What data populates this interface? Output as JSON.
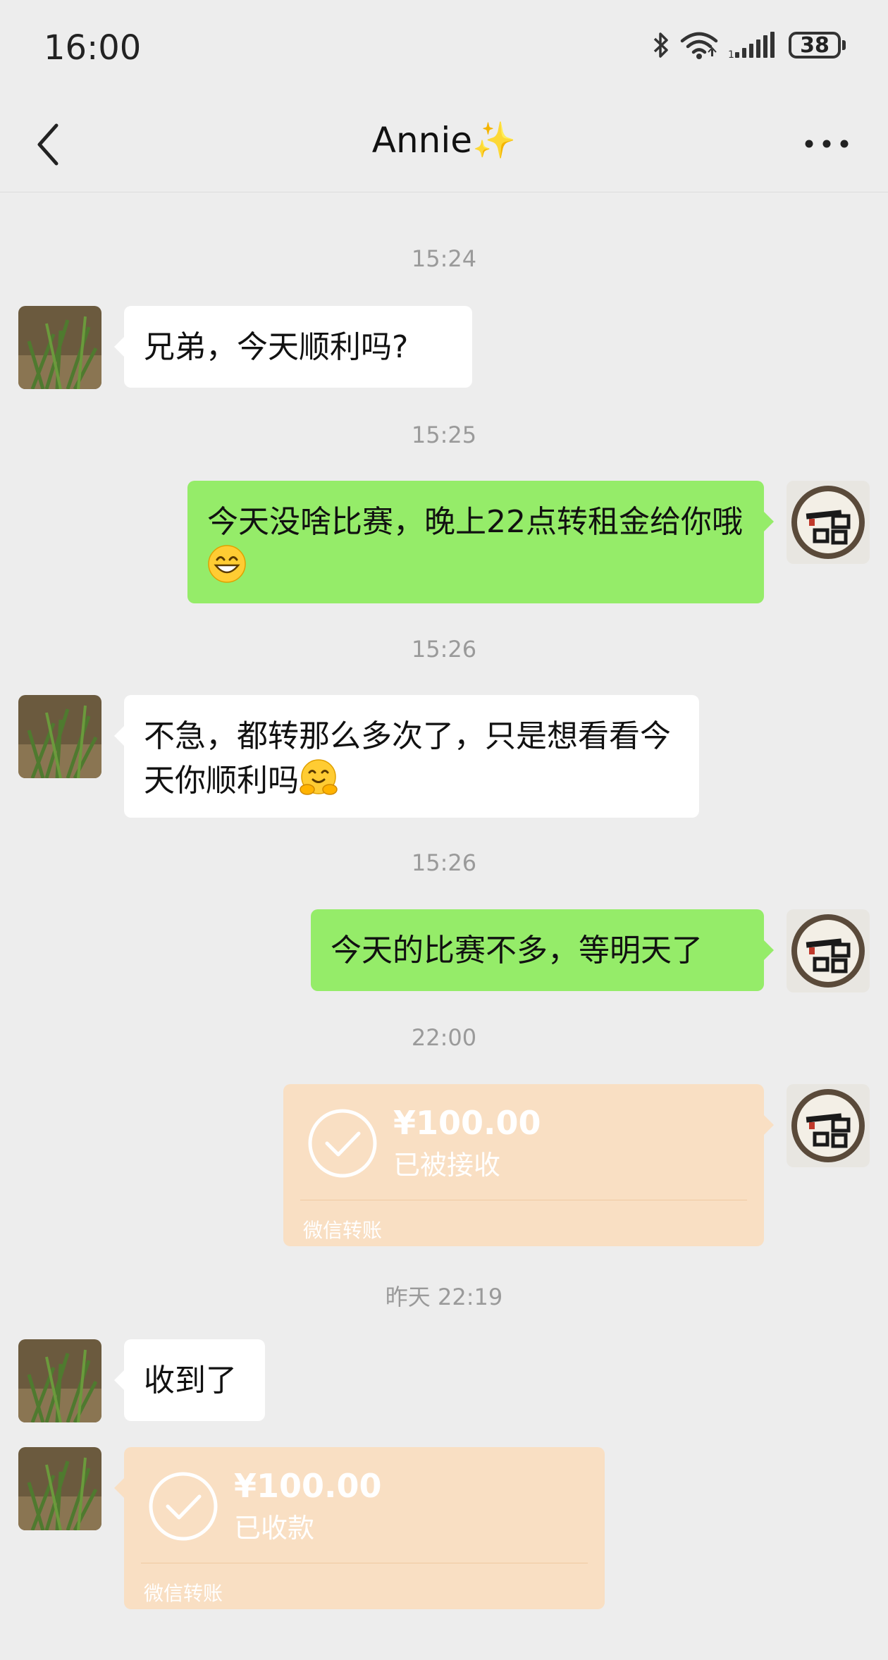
{
  "status_bar": {
    "time": "16:00",
    "battery": "38"
  },
  "nav": {
    "title": "Annie✨"
  },
  "colors": {
    "background": "#ededed",
    "bubble_out": "#95ec69",
    "bubble_in": "#ffffff",
    "transfer": "#f9dfc3"
  },
  "messages": [
    {
      "timestamp": "15:24"
    },
    {
      "text": "兄弟，今天顺利吗?"
    },
    {
      "timestamp": "15:25"
    },
    {
      "text": "今天没啥比赛，晚上22点转租金给你哦"
    },
    {
      "timestamp": "15:26"
    },
    {
      "text": "不急，都转那么多次了，只是想看看今天你顺利吗"
    },
    {
      "timestamp": "15:26"
    },
    {
      "text": "今天的比赛不多，等明天了"
    },
    {
      "timestamp": "22:00"
    },
    {
      "amount": "¥100.00",
      "status": "已被接收",
      "footer": "微信转账"
    },
    {
      "timestamp": "昨天 22:19"
    },
    {
      "text": "收到了"
    },
    {
      "amount": "¥100.00",
      "status": "已收款",
      "footer": "微信转账"
    }
  ],
  "icons": [
    "back-arrow-icon",
    "more-dots-icon",
    "bluetooth-icon",
    "wifi-icon",
    "signal-icon",
    "battery-icon",
    "check-icon",
    "grin-emoji",
    "hug-emoji"
  ]
}
